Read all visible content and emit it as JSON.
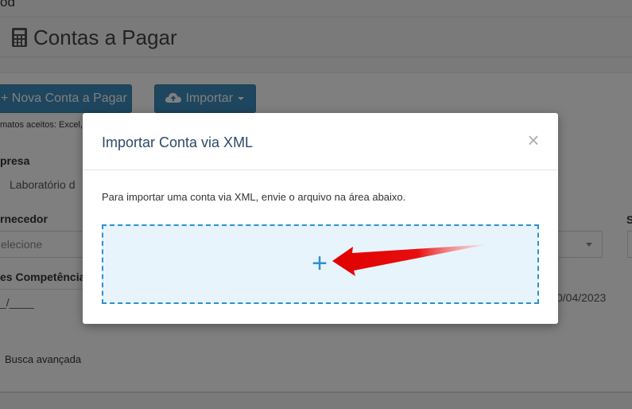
{
  "breadcrumb": {
    "text": "ód"
  },
  "header": {
    "title": "Contas a Pagar",
    "icon": "calculator-icon"
  },
  "toolbar": {
    "new_label": "+ Nova Conta a Pagar",
    "import_label": "Importar",
    "import_icon": "cloud-upload-icon",
    "formats_text": "matos aceitos: Excel,"
  },
  "filters": {
    "empresa_label": "presa",
    "empresa_value": "Laboratório d",
    "fornecedor_label": "rnecedor",
    "fornecedor_placeholder": "elecione",
    "competencia_label": "es Competência",
    "competencia_value": "_/____",
    "date_value": "0/04/2023",
    "edge_label": "S",
    "busca_label": "Busca avançada"
  },
  "modal": {
    "title": "Importar Conta via XML",
    "close_label": "×",
    "text": "Para importar uma conta via XML, envie o arquivo na área abaixo.",
    "dropzone_plus": "+"
  },
  "colors": {
    "primary": "#3c8dbc",
    "dropzone_border": "#2b8fd6",
    "dropzone_bg": "#e8f4fc",
    "arrow": "#e00000",
    "modal_title": "#2c4a6b"
  }
}
